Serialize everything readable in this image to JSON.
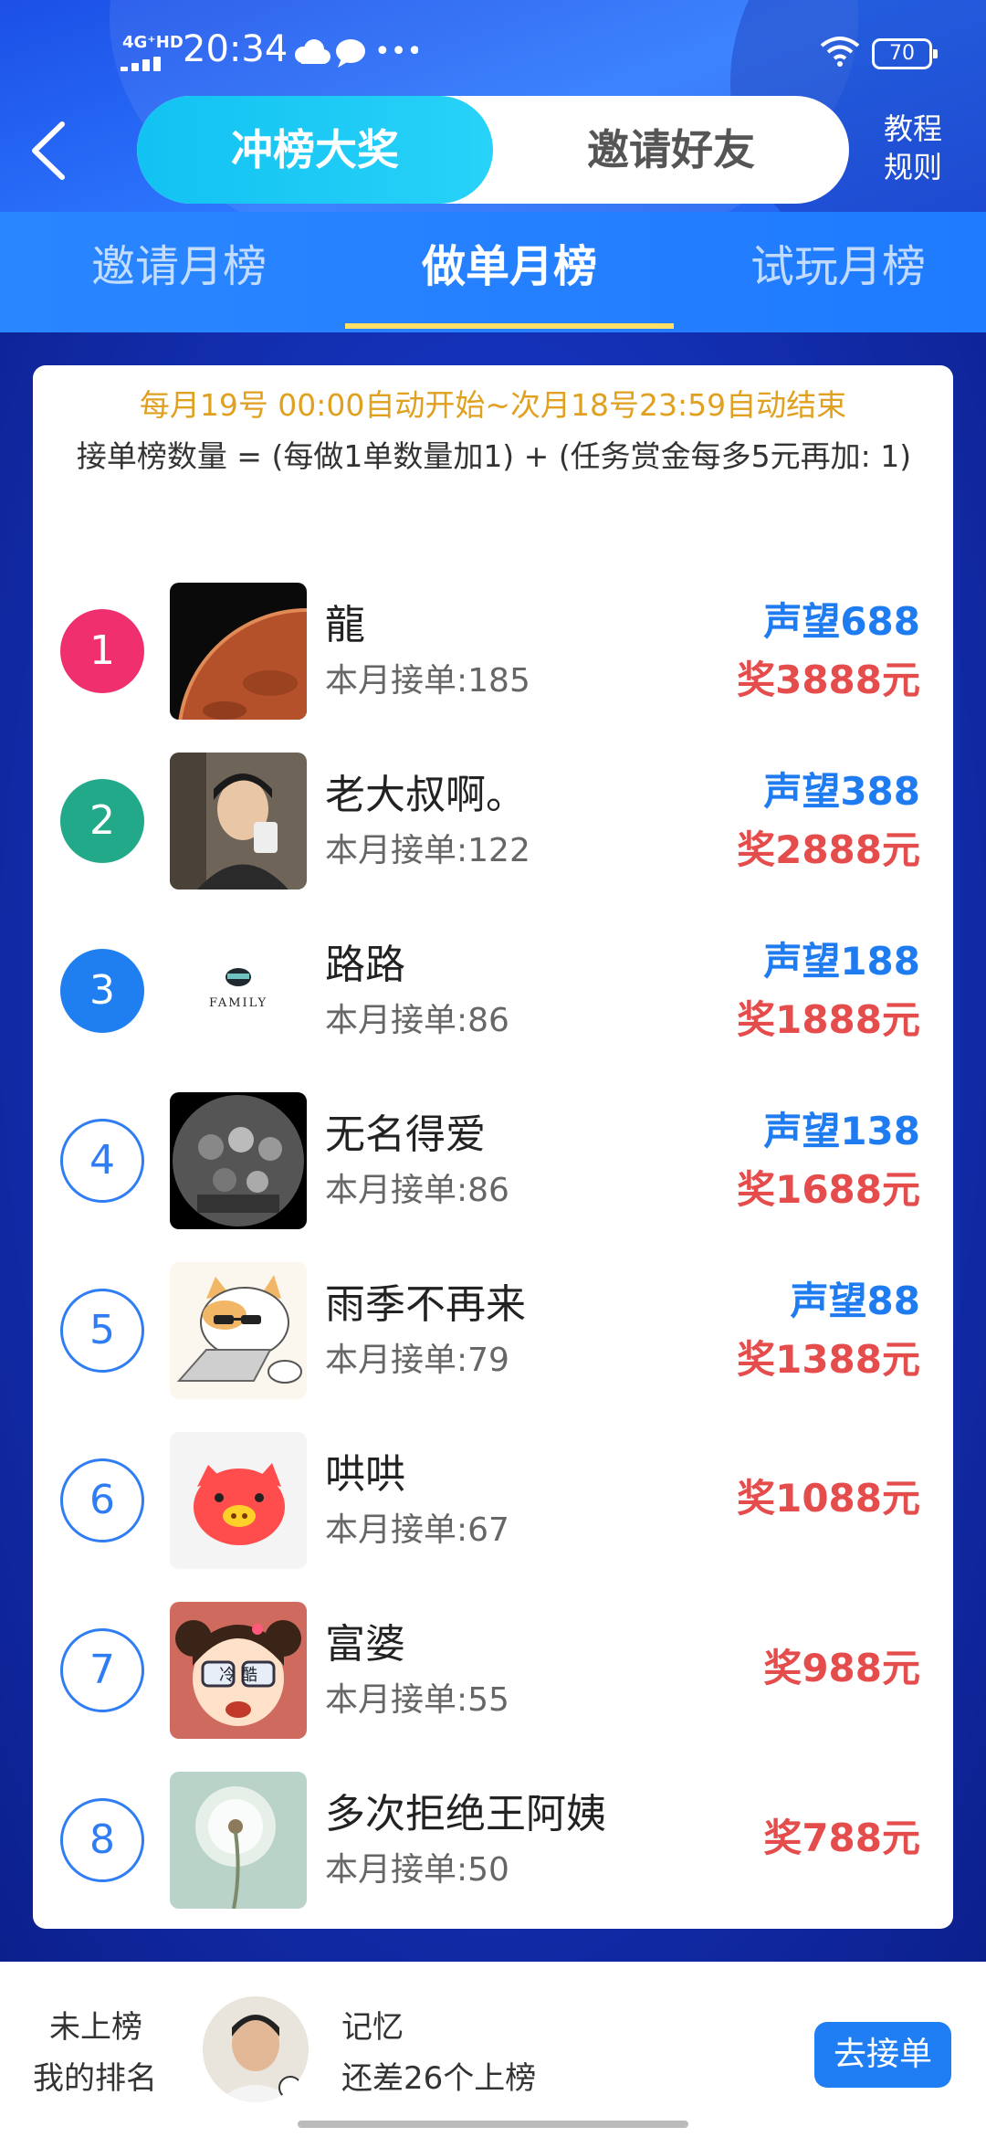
{
  "status_bar": {
    "network": "4G⁺HD",
    "time": "20:34",
    "more": "•••",
    "battery": "70"
  },
  "header": {
    "tab_active": "冲榜大奖",
    "tab_inactive": "邀请好友",
    "help_line1": "教程",
    "help_line2": "规则"
  },
  "sub_tabs": [
    "邀请月榜",
    "做单月榜",
    "试玩月榜"
  ],
  "notice": "每月19号 00:00自动开始~次月18号23:59自动结束",
  "formula": "接单榜数量 = (每做1单数量加1) + (任务赏金每多5元再加: 1)",
  "colors": {
    "rank1": "#f0306e",
    "rank2": "#22a98a",
    "rank3": "#1f7ff0",
    "reputation": "#1f7bf0",
    "reward": "#e54c4c",
    "accent": "#1f7ef4"
  },
  "leaderboard": [
    {
      "rank": "1",
      "name": "龍",
      "orders": "本月接单:185",
      "reputation": "声望688",
      "reward": "奖3888元",
      "avatar": "mars-planet-avatar"
    },
    {
      "rank": "2",
      "name": "老大叔啊。",
      "orders": "本月接单:122",
      "reputation": "声望388",
      "reward": "奖2888元",
      "avatar": "young-man-photo-avatar"
    },
    {
      "rank": "3",
      "name": "路路",
      "orders": "本月接单:86",
      "reputation": "声望188",
      "reward": "奖1888元",
      "avatar": "family-logo-avatar",
      "avatar_text": "FAMILY"
    },
    {
      "rank": "4",
      "name": "无名得爱",
      "orders": "本月接单:86",
      "reputation": "声望138",
      "reward": "奖1688元",
      "avatar": "group-photo-avatar"
    },
    {
      "rank": "5",
      "name": "雨季不再来",
      "orders": "本月接单:79",
      "reputation": "声望88",
      "reward": "奖1388元",
      "avatar": "cat-laptop-avatar"
    },
    {
      "rank": "6",
      "name": "哄哄",
      "orders": "本月接单:67",
      "reputation": "",
      "reward": "奖1088元",
      "avatar": "pig-cartoon-avatar"
    },
    {
      "rank": "7",
      "name": "富婆",
      "orders": "本月接单:55",
      "reputation": "",
      "reward": "奖988元",
      "avatar": "cartoon-girl-avatar",
      "avatar_text": "冷 酷"
    },
    {
      "rank": "8",
      "name": "多次拒绝王阿姨",
      "orders": "本月接单:50",
      "reputation": "",
      "reward": "奖788元",
      "avatar": "dandelion-avatar"
    }
  ],
  "my_rank": {
    "label_status": "未上榜",
    "label_title": "我的排名",
    "name": "记忆",
    "gap": "还差26个上榜",
    "button": "去接单"
  }
}
